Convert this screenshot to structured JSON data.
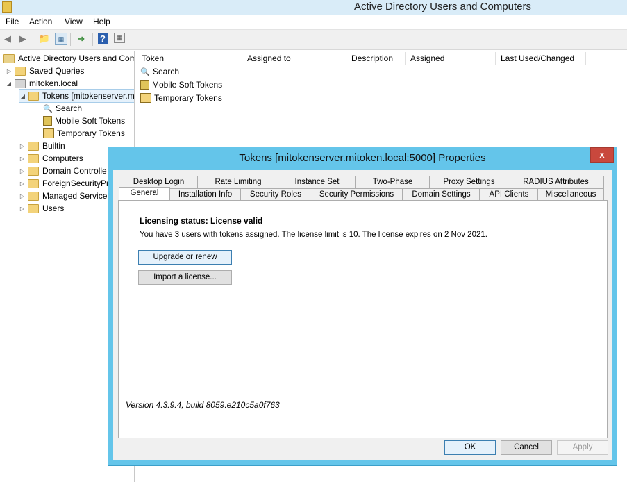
{
  "window": {
    "title": "Active Directory Users and Computers"
  },
  "menu": [
    "File",
    "Action",
    "View",
    "Help"
  ],
  "toolbar": {
    "icons": [
      "back-arrow-icon",
      "forward-arrow-icon",
      "up-folder-icon",
      "show-hide-tree-icon",
      "export-list-icon",
      "help-icon",
      "properties-view-icon"
    ]
  },
  "tree": {
    "root": "Active Directory Users and Com",
    "saved_queries": "Saved Queries",
    "domain": "mitoken.local",
    "tokens": "Tokens [mitokenserver.m",
    "search": "Search",
    "mobile_soft_tokens": "Mobile Soft Tokens",
    "temporary_tokens": "Temporary Tokens",
    "builtin": "Builtin",
    "computers": "Computers",
    "domain_controllers": "Domain Controlle",
    "foreign_security": "ForeignSecurityPr",
    "managed_service": "Managed Service",
    "users": "Users"
  },
  "list": {
    "columns": [
      "Token",
      "Assigned to",
      "Description",
      "Assigned",
      "Last Used/Changed"
    ],
    "items": [
      "Search",
      "Mobile Soft Tokens",
      "Temporary Tokens"
    ]
  },
  "dialog": {
    "title": "Tokens [mitokenserver.mitoken.local:5000] Properties",
    "close_label": "x",
    "tabs_row1": [
      "Desktop Login",
      "Rate Limiting",
      "Instance Set",
      "Two-Phase",
      "Proxy Settings",
      "RADIUS Attributes"
    ],
    "tabs_row2": [
      "General",
      "Installation Info",
      "Security Roles",
      "Security Permissions",
      "Domain Settings",
      "API Clients",
      "Miscellaneous"
    ],
    "status": "Licensing status: License valid",
    "info": "You have 3 users with tokens assigned. The license limit is 10. The license expires on 2 Nov 2021.",
    "upgrade_label": "Upgrade or renew",
    "import_label": "Import a license...",
    "version": "Version 4.3.9.4, build 8059.e210c5a0f763",
    "ok_label": "OK",
    "cancel_label": "Cancel",
    "apply_label": "Apply"
  }
}
